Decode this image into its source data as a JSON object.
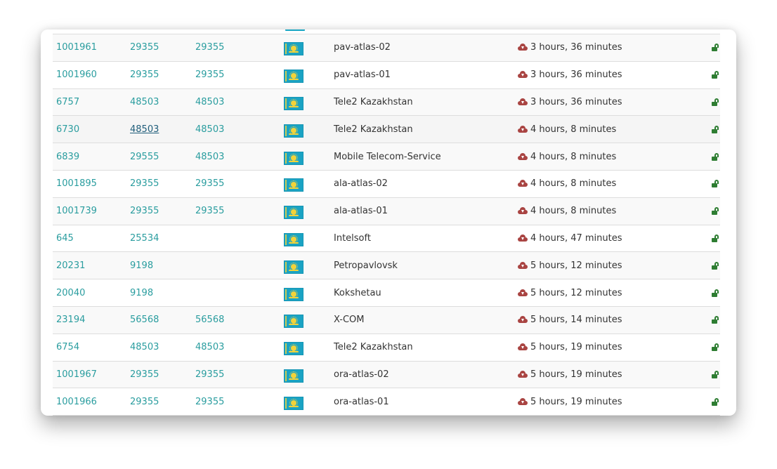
{
  "colors": {
    "link": "#2a9d9f",
    "status_down": "#a94442",
    "unlocked": "#2e7d32"
  },
  "icons": {
    "status": "cloud-download-icon",
    "lock": "unlock-icon",
    "flag": "kazakhstan-flag-icon"
  },
  "rows": [
    {
      "id": "1001961",
      "asn": "29355",
      "asn2": "29355",
      "description": "pav-atlas-02",
      "status": "3 hours, 36 minutes"
    },
    {
      "id": "1001960",
      "asn": "29355",
      "asn2": "29355",
      "description": "pav-atlas-01",
      "status": "3 hours, 36 minutes"
    },
    {
      "id": "6757",
      "asn": "48503",
      "asn2": "48503",
      "description": "Tele2 Kazakhstan",
      "status": "3 hours, 36 minutes"
    },
    {
      "id": "6730",
      "asn": "48503",
      "asn2": "48503",
      "description": "Tele2 Kazakhstan",
      "status": "4 hours, 8 minutes"
    },
    {
      "id": "6839",
      "asn": "29555",
      "asn2": "48503",
      "description": "Mobile Telecom-Service",
      "status": "4 hours, 8 minutes"
    },
    {
      "id": "1001895",
      "asn": "29355",
      "asn2": "29355",
      "description": "ala-atlas-02",
      "status": "4 hours, 8 minutes"
    },
    {
      "id": "1001739",
      "asn": "29355",
      "asn2": "29355",
      "description": "ala-atlas-01",
      "status": "4 hours, 8 minutes"
    },
    {
      "id": "645",
      "asn": "25534",
      "asn2": "",
      "description": "Intelsoft",
      "status": "4 hours, 47 minutes"
    },
    {
      "id": "20231",
      "asn": "9198",
      "asn2": "",
      "description": "Petropavlovsk",
      "status": "5 hours, 12 minutes"
    },
    {
      "id": "20040",
      "asn": "9198",
      "asn2": "",
      "description": "Kokshetau",
      "status": "5 hours, 12 minutes"
    },
    {
      "id": "23194",
      "asn": "56568",
      "asn2": "56568",
      "description": "X-COM",
      "status": "5 hours, 14 minutes"
    },
    {
      "id": "6754",
      "asn": "48503",
      "asn2": "48503",
      "description": "Tele2 Kazakhstan",
      "status": "5 hours, 19 minutes"
    },
    {
      "id": "1001967",
      "asn": "29355",
      "asn2": "29355",
      "description": "ora-atlas-02",
      "status": "5 hours, 19 minutes"
    },
    {
      "id": "1001966",
      "asn": "29355",
      "asn2": "29355",
      "description": "ora-atlas-01",
      "status": "5 hours, 19 minutes"
    }
  ]
}
